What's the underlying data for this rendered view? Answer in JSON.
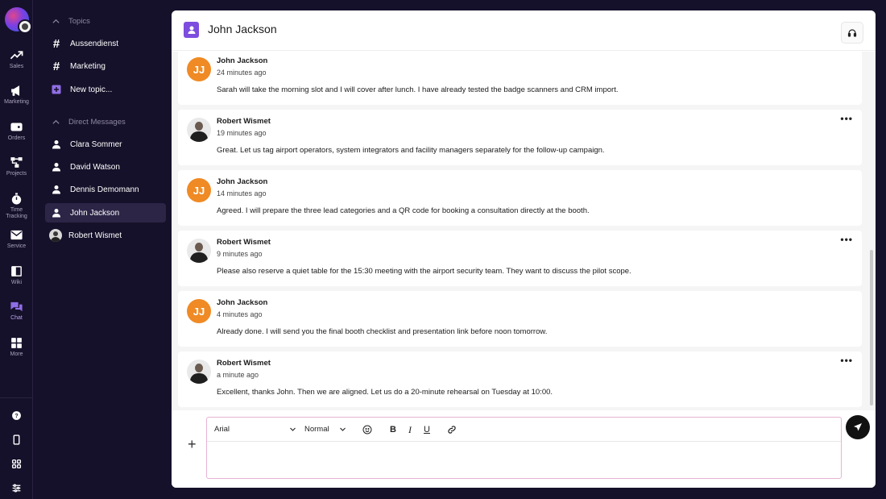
{
  "rail": {
    "items": [
      {
        "label": "Sales",
        "icon": "trending-up-icon"
      },
      {
        "label": "Marketing",
        "icon": "megaphone-icon"
      },
      {
        "label": "Orders",
        "icon": "tag-icon"
      },
      {
        "label": "Projects",
        "icon": "flow-icon"
      },
      {
        "label": "Time Tracking",
        "icon": "stopwatch-icon"
      },
      {
        "label": "Service",
        "icon": "mail-icon"
      },
      {
        "label": "Wiki",
        "icon": "book-icon"
      },
      {
        "label": "Chat",
        "icon": "chat-bubbles-icon"
      },
      {
        "label": "More",
        "icon": "grid-icon"
      }
    ],
    "accent": "#8f6ee6"
  },
  "sidebar": {
    "topics_header": "Topics",
    "topics": [
      {
        "label": "Aussendienst"
      },
      {
        "label": "Marketing"
      },
      {
        "label": "New topic..."
      }
    ],
    "dm_header": "Direct Messages",
    "dms": [
      {
        "label": "Clara Sommer"
      },
      {
        "label": "David Watson"
      },
      {
        "label": "Dennis Demomann"
      },
      {
        "label": "John Jackson"
      },
      {
        "label": "Robert Wismet"
      }
    ]
  },
  "header": {
    "title": "John Jackson"
  },
  "messages": [
    {
      "initials": "JJ",
      "author": "John Jackson",
      "time": "24 minutes ago",
      "text": "Sarah will take the morning slot and I will cover after lunch. I have already tested the badge scanners and CRM import."
    },
    {
      "initials": "",
      "author": "Robert Wismet",
      "time": "19 minutes ago",
      "text": "Great. Let us tag airport operators, system integrators and facility managers separately for the follow-up campaign."
    },
    {
      "initials": "JJ",
      "author": "John Jackson",
      "time": "14 minutes ago",
      "text": "Agreed. I will prepare the three lead categories and a QR code for booking a consultation directly at the booth."
    },
    {
      "initials": "",
      "author": "Robert Wismet",
      "time": "9 minutes ago",
      "text": "Please also reserve a quiet table for the 15:30 meeting with the airport security team. They want to discuss the pilot scope."
    },
    {
      "initials": "JJ",
      "author": "John Jackson",
      "time": "4 minutes ago",
      "text": "Already done. I will send you the final booth checklist and presentation link before noon tomorrow."
    },
    {
      "initials": "",
      "author": "Robert Wismet",
      "time": "a minute ago",
      "text": "Excellent, thanks John. Then we are aligned. Let us do a 20-minute rehearsal on Tuesday at 10:00."
    }
  ],
  "more_label": "•••",
  "composer": {
    "font": "Arial",
    "size": "Normal",
    "bold": "B",
    "italic": "I",
    "underline": "U",
    "plus": "+"
  },
  "colors": {
    "jj_avatar": "#ef8a24",
    "header_icon": "#7c4dde"
  }
}
